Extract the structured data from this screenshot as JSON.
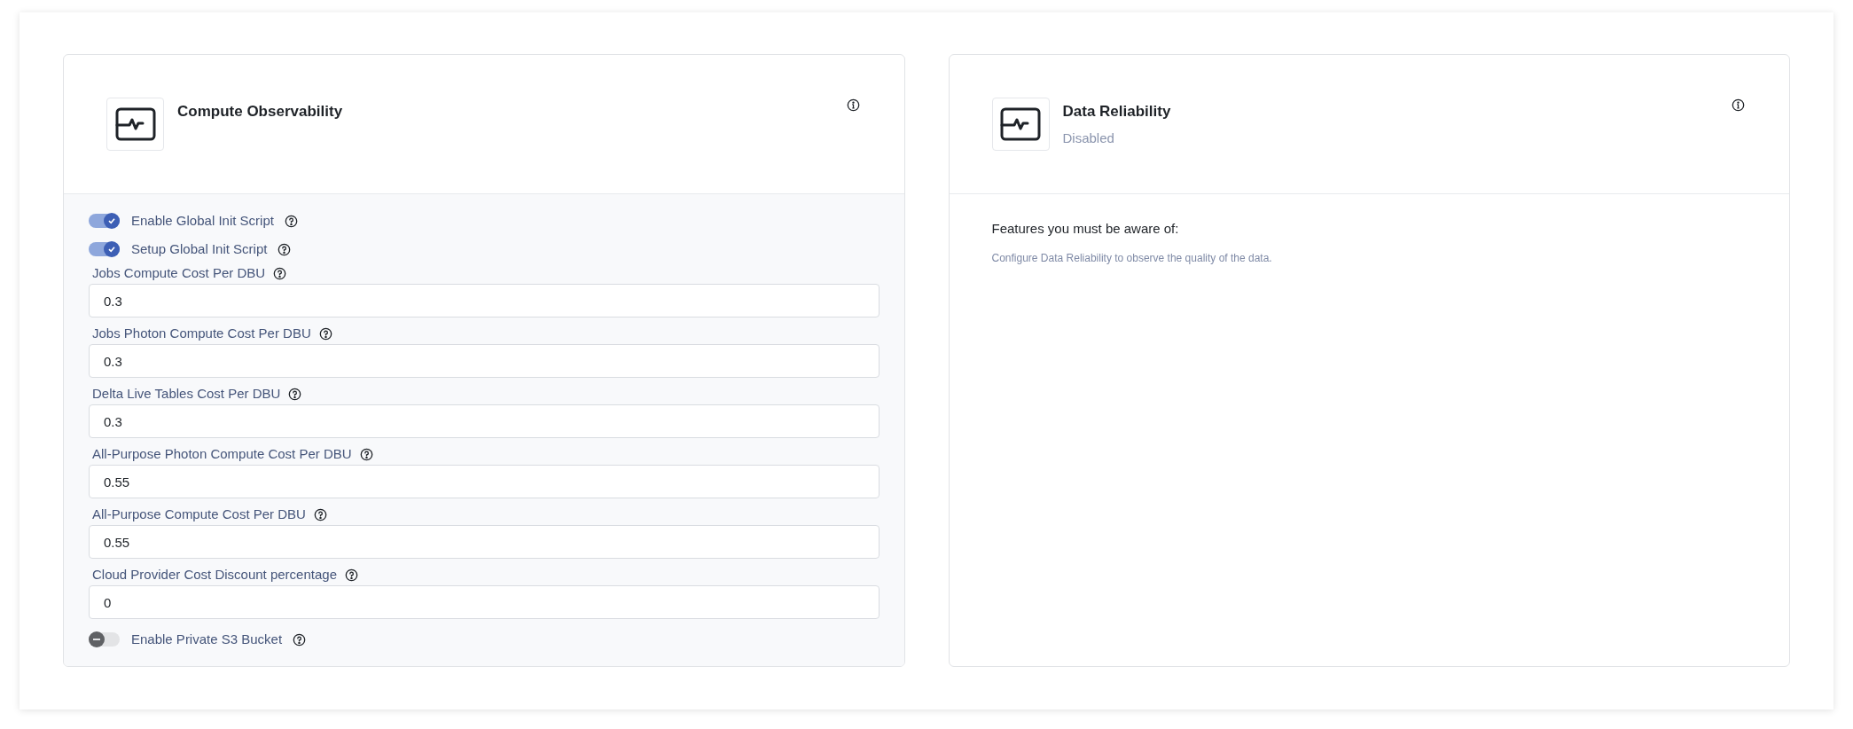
{
  "cards": [
    {
      "title": "Compute Observability",
      "settings": [
        {
          "kind": "toggle",
          "label": "Enable Global Init Script",
          "on": true
        },
        {
          "kind": "toggle",
          "label": "Setup Global Init Script",
          "on": true
        },
        {
          "kind": "field",
          "label": "Jobs Compute Cost Per DBU",
          "value": "0.3"
        },
        {
          "kind": "field",
          "label": "Jobs Photon Compute Cost Per DBU",
          "value": "0.3"
        },
        {
          "kind": "field",
          "label": "Delta Live Tables Cost Per DBU",
          "value": "0.3"
        },
        {
          "kind": "field",
          "label": "All-Purpose Photon Compute Cost Per DBU",
          "value": "0.55"
        },
        {
          "kind": "field",
          "label": "All-Purpose Compute Cost Per DBU",
          "value": "0.55"
        },
        {
          "kind": "field",
          "label": "Cloud Provider Cost Discount percentage",
          "value": "0"
        },
        {
          "kind": "toggle",
          "label": "Enable Private S3 Bucket",
          "on": false
        }
      ]
    },
    {
      "title": "Data Reliability",
      "status": "Disabled",
      "features_heading": "Features you must be aware of:",
      "features_text": "Configure Data Reliability to observe the quality of the data."
    }
  ]
}
